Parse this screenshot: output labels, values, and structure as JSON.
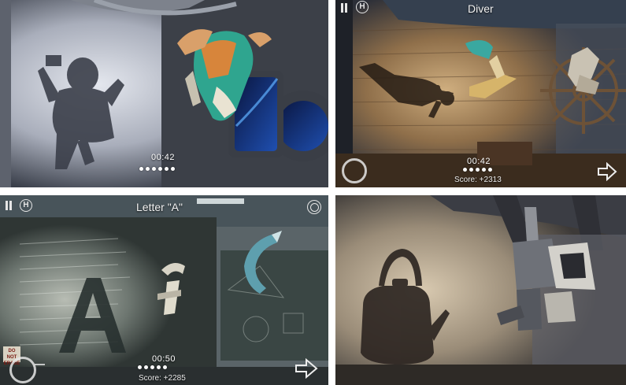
{
  "screens": [
    {
      "theme": "space-station",
      "timer": "00:42",
      "progress_dots": 6
    },
    {
      "theme": "shipwreck",
      "title": "Diver",
      "timer": "00:42",
      "score": "Score: +2313",
      "progress_dots": 5,
      "controls": [
        "pause-icon",
        "hint-icon",
        "rotate-ring",
        "next-arrow-icon"
      ]
    },
    {
      "theme": "classroom",
      "title": "Letter \"A\"",
      "timer": "00:50",
      "score": "Score: +2285",
      "progress_dots": 5,
      "sign": "DO NOT ERASE",
      "controls": [
        "pause-icon",
        "hint-icon",
        "settings-ring-icon",
        "rotate-ring",
        "next-arrow-icon"
      ]
    },
    {
      "theme": "attic",
      "shadow_subject": "teakettle"
    }
  ],
  "colors": {
    "hud_text": "#ffffff",
    "space_light": "#c8ccd6",
    "wood": "#8a6a44",
    "chalkboard": "#3c4a48"
  }
}
